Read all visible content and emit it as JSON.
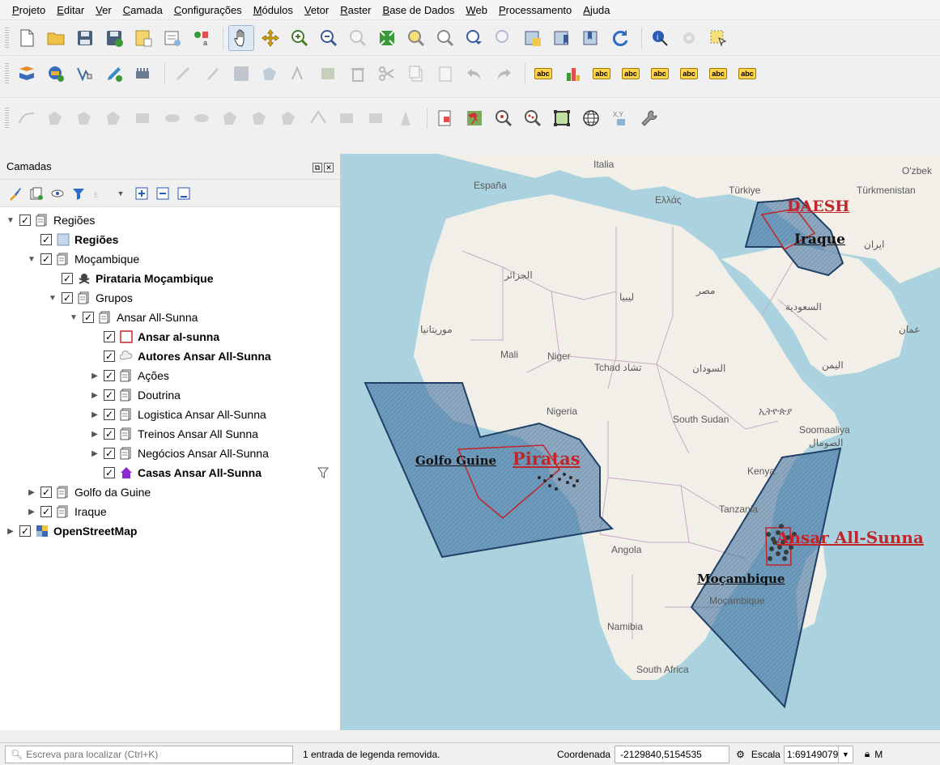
{
  "menu": [
    "Projeto",
    "Editar",
    "Ver",
    "Camada",
    "Configurações",
    "Módulos",
    "Vetor",
    "Raster",
    "Base de Dados",
    "Web",
    "Processamento",
    "Ajuda"
  ],
  "toolbar": {
    "label_tool_text": "abc"
  },
  "layers_panel": {
    "title": "Camadas",
    "tree": [
      {
        "label": "Regiões",
        "level": 0,
        "type": "group",
        "expanded": true,
        "bold": false
      },
      {
        "label": "Regiões",
        "level": 1,
        "type": "polygon-blue",
        "bold": true
      },
      {
        "label": "Moçambique",
        "level": 1,
        "type": "group",
        "expanded": true,
        "bold": false
      },
      {
        "label": "Pirataria Moçambique",
        "level": 2,
        "type": "pirate",
        "bold": true
      },
      {
        "label": "Grupos",
        "level": 2,
        "type": "group",
        "expanded": true,
        "bold": false
      },
      {
        "label": "Ansar All-Sunna",
        "level": 3,
        "type": "group",
        "expanded": true,
        "bold": false
      },
      {
        "label": "Ansar al-sunna",
        "level": 4,
        "type": "polygon-red",
        "bold": true
      },
      {
        "label": "Autores Ansar All-Sunna",
        "level": 4,
        "type": "cloud",
        "bold": true
      },
      {
        "label": "Ações",
        "level": 4,
        "type": "group",
        "expanded": false,
        "bold": false
      },
      {
        "label": "Doutrina",
        "level": 4,
        "type": "group",
        "expanded": false,
        "bold": false
      },
      {
        "label": "Logistica Ansar All-Sunna",
        "level": 4,
        "type": "group",
        "expanded": false,
        "bold": false
      },
      {
        "label": "Treinos Ansar All Sunna",
        "level": 4,
        "type": "group",
        "expanded": false,
        "bold": false
      },
      {
        "label": "Negócios Ansar All-Sunna",
        "level": 4,
        "type": "group",
        "expanded": false,
        "bold": false
      },
      {
        "label": "Casas Ansar All-Sunna",
        "level": 4,
        "type": "house",
        "bold": true,
        "filter": true
      },
      {
        "label": "Golfo da Guine",
        "level": 1,
        "type": "group",
        "expanded": false,
        "bold": false
      },
      {
        "label": "Iraque",
        "level": 1,
        "type": "group",
        "expanded": false,
        "bold": false
      },
      {
        "label": "OpenStreetMap",
        "level": 0,
        "type": "raster",
        "bold": true,
        "expanded": false
      }
    ]
  },
  "map": {
    "base_labels": [
      "España",
      "Italia",
      "Ελλάς",
      "Türkiye",
      "O'zbek",
      "Türkmenistan",
      "ایران",
      "الجزائر",
      "ليبيا",
      "مصر",
      "السعودية",
      "موريتانيا",
      "Mali",
      "Niger",
      "Tchad تشاد",
      "السودان",
      "اليمن",
      "عمان",
      "Nigeria",
      "South Sudan",
      "ኢትዮጵያ",
      "Soomaaliya",
      "الصومال",
      "Kenya",
      "Tanzania",
      "Angola",
      "Moçambique",
      "Namibia",
      "South Africa"
    ],
    "annotations": {
      "daesh": "DAESH",
      "iraque": "Iraque",
      "golfo": "Golfo Guine",
      "piratas": "Piratas",
      "ansar": "Ansar All-Sunna",
      "mocambique": "Moçambique"
    },
    "colors": {
      "sea": "#aad3df",
      "land": "#f2efe9",
      "region_fill": "#3d6e9e",
      "region_stroke": "#1f3f66",
      "red": "#c0262a"
    }
  },
  "statusbar": {
    "locator_placeholder": "Escreva para localizar (Ctrl+K)",
    "message": "1 entrada de legenda removida.",
    "coord_label": "Coordenada",
    "coord_value": "-2129840,5154535",
    "scale_label": "Escala",
    "scale_value": "1:69149079",
    "tail": "M"
  }
}
